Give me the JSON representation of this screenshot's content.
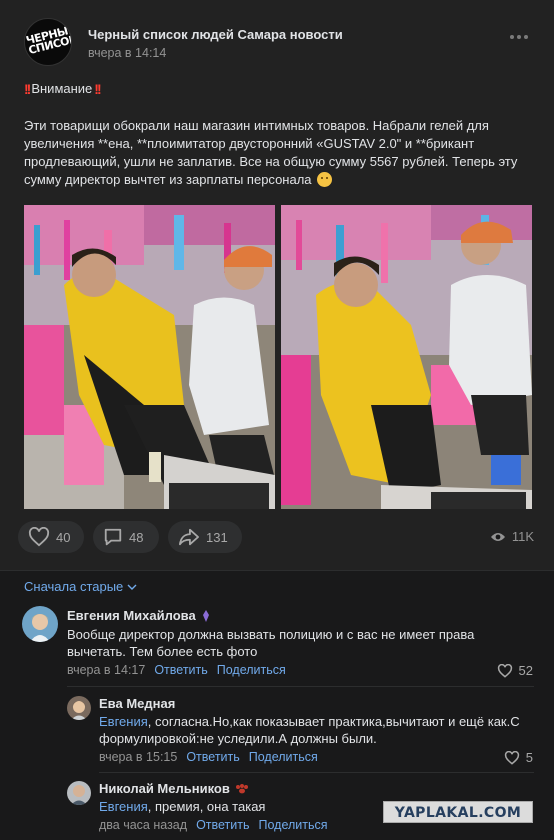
{
  "post": {
    "group_name": "Черный список людей Самара новости",
    "time": "вчера в 14:14",
    "avatar_text": "ЧЕРНЫЙ СПИСОК",
    "attention": "Внимание",
    "body": "Эти товарищи обокрали наш магазин интимных товаров. Набрали гелей для увеличения **ена, **плоимитатор двусторонний «GUSTAV 2.0\" и **брикант продлевающий, ушли не заплатив. Все на общую сумму 5567 рублей. Теперь эту сумму директор вычтет из зарплаты персонала",
    "likes": "40",
    "comments": "48",
    "shares": "131",
    "views": "11K"
  },
  "comments_header": {
    "sort_label": "Сначала старые"
  },
  "comments": [
    {
      "name": "Евгения Михайлова",
      "text": "Вообще директор должна вызвать полицию и с вас не имеет права вычетать. Тем более есть фото",
      "time": "вчера в 14:17",
      "reply_label": "Ответить",
      "share_label": "Поделиться",
      "likes": "52"
    }
  ],
  "replies": [
    {
      "name": "Ева Медная",
      "mention": "Евгения",
      "text": ", согласна.Но,как показывает практика,вычитают и ещё как.С формулировкой:не уследили.А должны были.",
      "time": "вчера в 15:15",
      "reply_label": "Ответить",
      "share_label": "Поделиться",
      "likes": "5"
    },
    {
      "name": "Николай Мельников",
      "mention": "Евгения",
      "text": ", премия, она такая",
      "time": "два часа назад",
      "reply_label": "Ответить",
      "share_label": "Поделиться"
    }
  ],
  "watermark": "YAPLAKAL.COM",
  "colors": {
    "accent": "#71aaeb",
    "background": "#19191a",
    "card": "#222222",
    "attention": "#ff3b30"
  }
}
